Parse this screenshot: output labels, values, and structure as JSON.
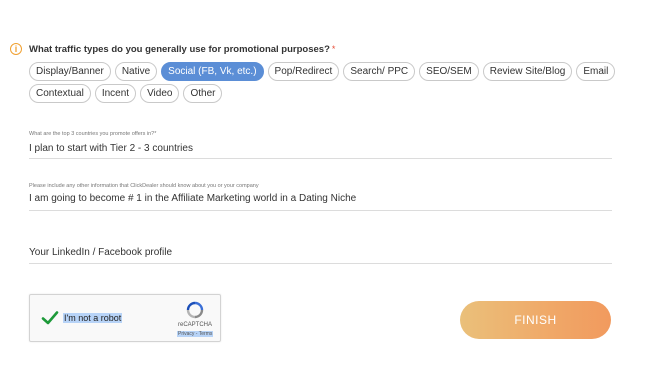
{
  "question": {
    "text": "What traffic types do you generally use for promotional purposes?",
    "required_mark": "*"
  },
  "traffic_types": [
    {
      "label": "Display/Banner",
      "selected": false
    },
    {
      "label": "Native",
      "selected": false
    },
    {
      "label": "Social (FB, Vk, etc.)",
      "selected": true
    },
    {
      "label": "Pop/Redirect",
      "selected": false
    },
    {
      "label": "Search/ PPC",
      "selected": false
    },
    {
      "label": "SEO/SEM",
      "selected": false
    },
    {
      "label": "Review Site/Blog",
      "selected": false
    },
    {
      "label": "Email",
      "selected": false
    },
    {
      "label": "Contextual",
      "selected": false
    },
    {
      "label": "Incent",
      "selected": false
    },
    {
      "label": "Video",
      "selected": false
    },
    {
      "label": "Other",
      "selected": false
    }
  ],
  "countries_field": {
    "label": "What are the top 3 countries you promote offers in?*",
    "value": "I plan to start with Tier 2 - 3 countries"
  },
  "info_field": {
    "label": "Please include any other information that ClickDealer should know about you or your company",
    "value": "I am going to become # 1 in the Affiliate Marketing world in a Dating Niche"
  },
  "profile_field": {
    "placeholder": "Your LinkedIn / Facebook profile"
  },
  "captcha": {
    "label": "I'm not a robot",
    "brand": "reCAPTCHA",
    "links": "Privacy - Terms"
  },
  "finish_button": "FINISH",
  "colors": {
    "accent": "#5b8ed6",
    "finish_start": "#eac07a",
    "finish_end": "#f19a5e",
    "info_icon": "#f0a030",
    "check": "#1e9a3a"
  }
}
